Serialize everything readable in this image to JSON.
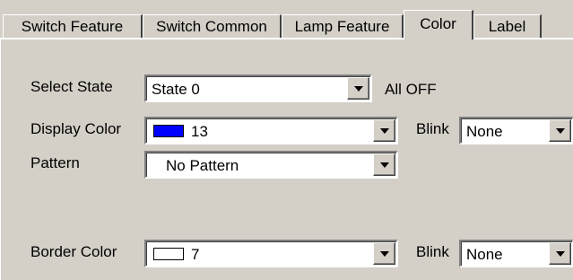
{
  "tabs": [
    {
      "label": "Switch Feature",
      "active": false
    },
    {
      "label": "Switch Common",
      "active": false
    },
    {
      "label": "Lamp Feature",
      "active": false
    },
    {
      "label": "Color",
      "active": true
    },
    {
      "label": "Label",
      "active": false
    }
  ],
  "select_state": {
    "label": "Select State",
    "value": "State 0",
    "status": "All OFF"
  },
  "display_color": {
    "label": "Display Color",
    "value": "13",
    "swatch_color": "#0000ff"
  },
  "display_blink": {
    "label": "Blink",
    "value": "None"
  },
  "pattern": {
    "label": "Pattern",
    "value": "No Pattern"
  },
  "border_color": {
    "label": "Border Color",
    "value": "7",
    "swatch_color": "#ffffff"
  },
  "border_blink": {
    "label": "Blink",
    "value": "None"
  }
}
